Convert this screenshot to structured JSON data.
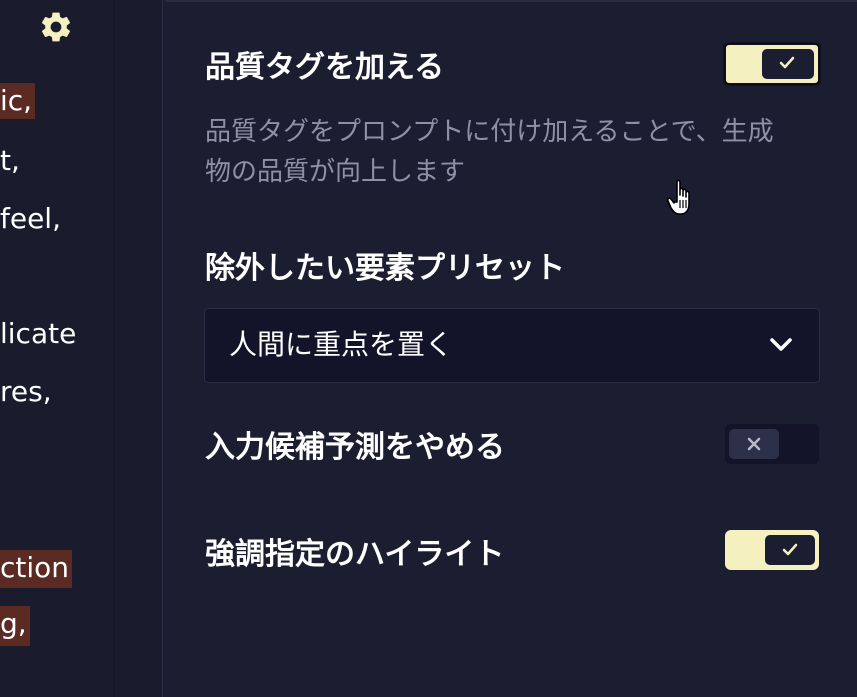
{
  "left_editor": {
    "fragments": [
      {
        "text": "ic,",
        "highlight": true
      },
      {
        "text": "t,",
        "highlight": false
      },
      {
        "text": "feel,",
        "highlight": false
      },
      {
        "text": "licate",
        "highlight": false
      },
      {
        "text": "res,",
        "highlight": false
      },
      {
        "text": "ction",
        "highlight": true
      },
      {
        "text": "g,",
        "highlight": true
      }
    ],
    "gear_icon": "gear-icon"
  },
  "settings": {
    "quality_tags": {
      "title": "品質タグを加える",
      "description": "品質タグをプロンプトに付け加えることで、生成物の品質が向上します",
      "enabled": true
    },
    "exclude_preset": {
      "title": "除外したい要素プリセット",
      "selected": "人間に重点を置く",
      "icon": "chevron-down-icon"
    },
    "disable_autocomplete": {
      "title": "入力候補予測をやめる",
      "enabled": false
    },
    "emphasis_highlight": {
      "title": "強調指定のハイライト",
      "enabled": true
    }
  },
  "colors": {
    "background": "#1a1c2e",
    "toggle_on": "#f5f0c0",
    "highlight": "#5a2a23",
    "gear": "#f5f0c0"
  }
}
